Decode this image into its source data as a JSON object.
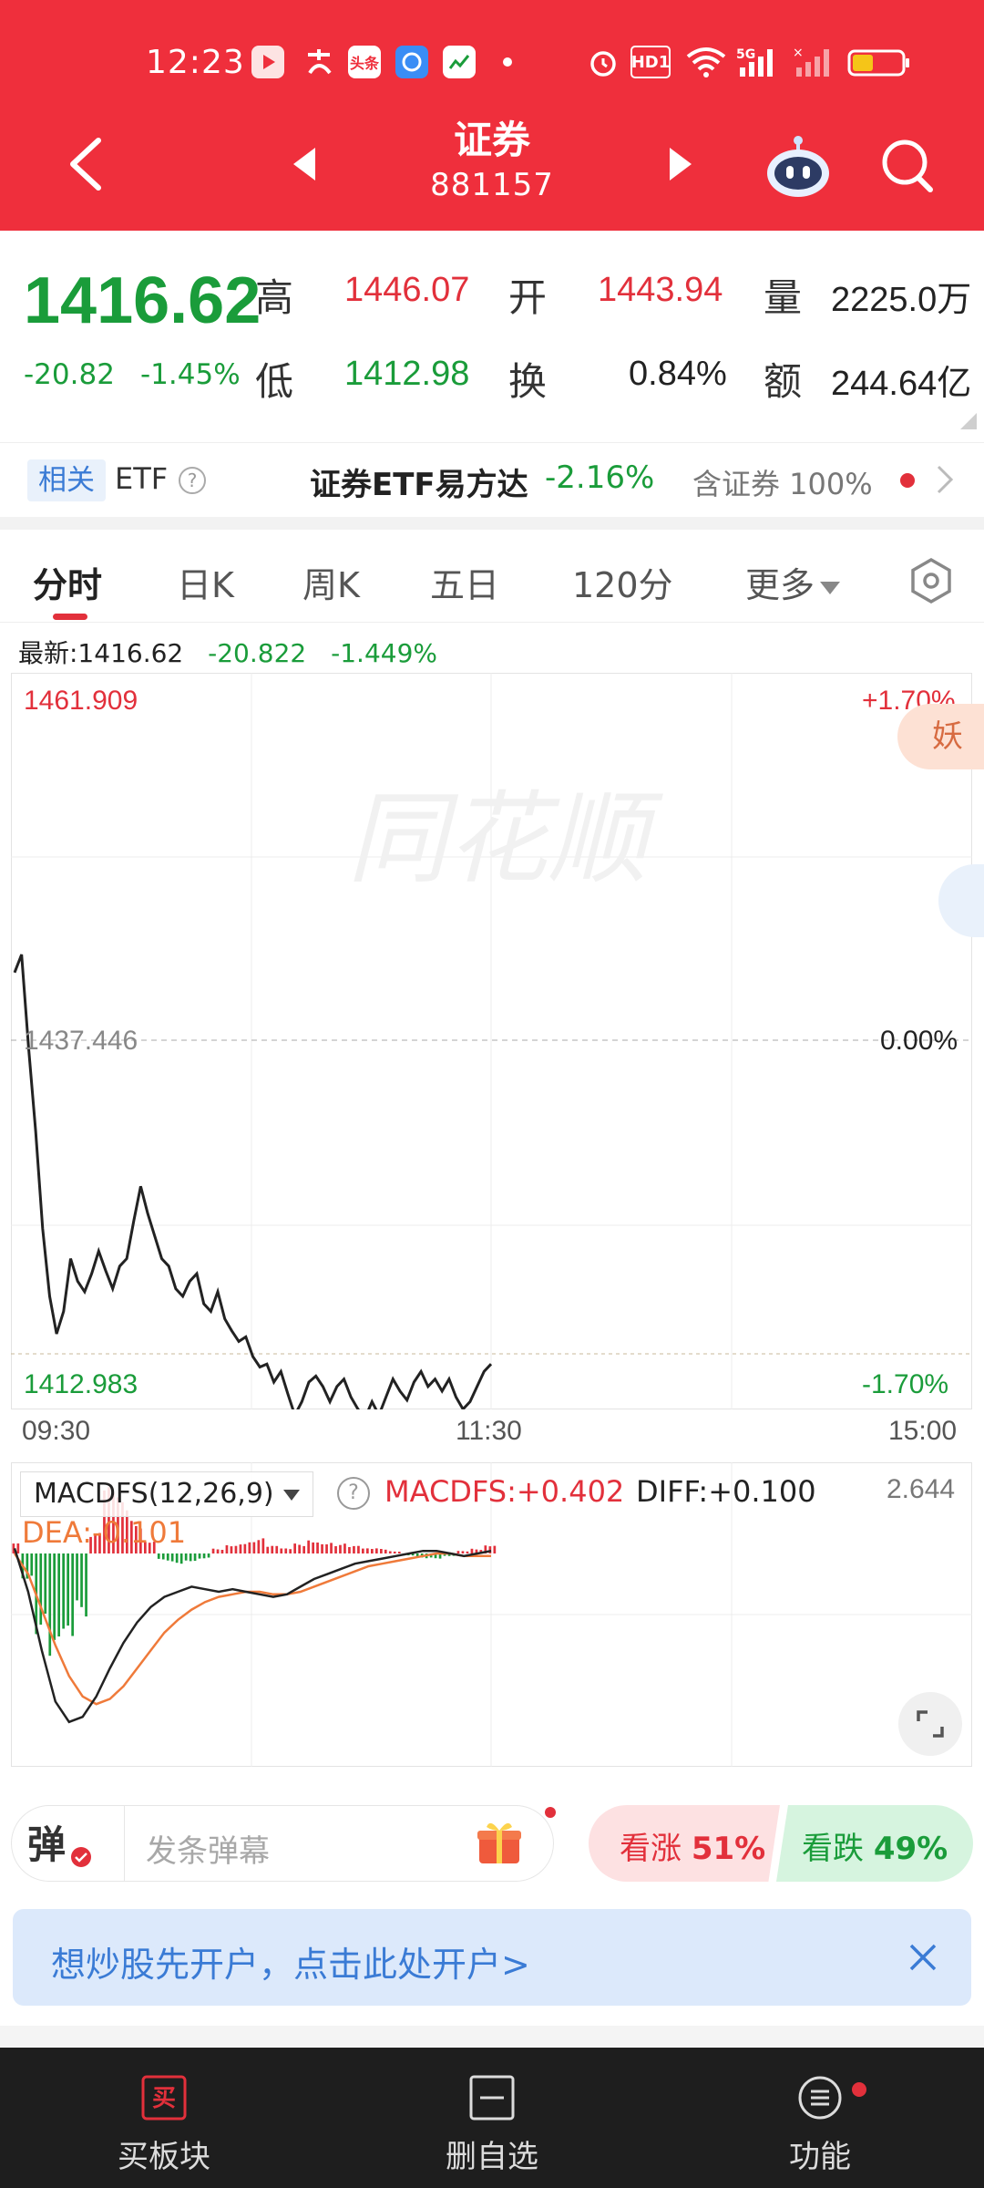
{
  "status_bar": {
    "time": "12:23",
    "icons": [
      "video-app-icon",
      "alipay-icon",
      "toutiao-icon",
      "browser-icon",
      "tonghuashun-icon",
      "more-dot",
      "alarm-icon",
      "hd-icon",
      "wifi-icon",
      "signal-5g-icon",
      "signal-icon",
      "battery-icon"
    ],
    "hd_text": "HD1",
    "net_text": "5G"
  },
  "header": {
    "title": "证券",
    "code": "881157"
  },
  "quote": {
    "price": "1416.62",
    "change": "-20.82",
    "change_pct": "-1.45%",
    "high_label": "高",
    "high": "1446.07",
    "open_label": "开",
    "open": "1443.94",
    "volume_label": "量",
    "volume": "2225.0万",
    "low_label": "低",
    "low": "1412.98",
    "turnover_label": "换",
    "turnover": "0.84%",
    "amount_label": "额",
    "amount": "244.64亿"
  },
  "etf": {
    "tag": "相关",
    "label": "ETF",
    "name": "证券ETF易方达",
    "change": "-2.16%",
    "holding": "含证券 100%"
  },
  "tabs": [
    {
      "label": "分时"
    },
    {
      "label": "日K"
    },
    {
      "label": "周K"
    },
    {
      "label": "五日"
    },
    {
      "label": "120分"
    },
    {
      "label": "更多"
    }
  ],
  "chart_info": {
    "latest": "最新:1416.62",
    "change": "-20.822",
    "change_pct": "-1.449%"
  },
  "price_chart": {
    "top_value": "1461.909",
    "top_pct": "+1.70%",
    "mid_value": "1437.446",
    "mid_pct": "0.00%",
    "bottom_value": "1412.983",
    "bottom_pct": "-1.70%",
    "side_tag": "妖股",
    "watermark": "同花顺",
    "times": [
      "09:30",
      "11:30",
      "15:00"
    ]
  },
  "macd": {
    "selector": "MACDFS(12,26,9)",
    "macdfs": "MACDFS:+0.402",
    "diff": "DIFF:+0.100",
    "dea": "DEA:-0.101",
    "max": "2.644"
  },
  "bullet": {
    "toggle": "弹",
    "placeholder": "发条弹幕"
  },
  "vote": {
    "up_label": "看涨",
    "up_pct": "51%",
    "down_label": "看跌",
    "down_pct": "49%"
  },
  "promo": {
    "text": "想炒股先开户，点击此处开户>"
  },
  "bottom_nav": {
    "buy_icon_text": "买",
    "buy": "买板块",
    "remove": "删自选",
    "functions": "功能"
  },
  "chart_data": {
    "type": "line",
    "x_axis": [
      "09:30",
      "11:30",
      "15:00"
    ],
    "y_range": [
      1412.983,
      1461.909
    ],
    "baseline": 1437.446,
    "grid": true,
    "series": [
      {
        "values": [
          1442.0,
          1443.2,
          1437.0,
          1431.5,
          1425.0,
          1420.5,
          1418.0,
          1419.5,
          1423.0,
          1421.5,
          1420.8,
          1422.0,
          1423.5,
          1422.2,
          1421.0,
          1422.5,
          1423.0,
          1425.5,
          1427.8,
          1426.0,
          1424.5,
          1423.0,
          1422.5,
          1421.0,
          1420.5,
          1421.5,
          1422.0,
          1420.0,
          1419.5,
          1420.8,
          1419.0,
          1418.2,
          1417.5,
          1417.8,
          1416.5,
          1415.8,
          1416.0,
          1414.8,
          1415.5,
          1414.0,
          1412.6,
          1413.5,
          1414.8,
          1415.2,
          1414.5,
          1413.5,
          1414.5,
          1415.0,
          1413.8,
          1413.0,
          1412.4,
          1413.5,
          1412.6,
          1413.8,
          1415.0,
          1414.2,
          1413.6,
          1414.8,
          1415.5,
          1414.5,
          1415.0,
          1414.2,
          1415.0,
          1413.8,
          1413.0,
          1413.5,
          1414.5,
          1415.5,
          1416.0
        ]
      }
    ]
  },
  "macd_data": {
    "type": "bar",
    "diff": [
      0.2,
      -1.5,
      -3.8,
      -5.8,
      -6.6,
      -6.4,
      -5.6,
      -4.5,
      -3.5,
      -2.7,
      -2.1,
      -1.7,
      -1.5,
      -1.3,
      -1.4,
      -1.5,
      -1.4,
      -1.5,
      -1.6,
      -1.7,
      -1.6,
      -1.3,
      -1.0,
      -0.8,
      -0.6,
      -0.4,
      -0.3,
      -0.2,
      -0.1,
      0.0,
      0.1,
      0.1,
      0.0,
      -0.1,
      0.0,
      0.1
    ],
    "dea": [
      0.0,
      -0.8,
      -2.2,
      -3.6,
      -4.8,
      -5.6,
      -5.9,
      -5.7,
      -5.2,
      -4.5,
      -3.8,
      -3.1,
      -2.6,
      -2.2,
      -1.9,
      -1.7,
      -1.6,
      -1.5,
      -1.5,
      -1.6,
      -1.6,
      -1.5,
      -1.3,
      -1.1,
      -0.9,
      -0.7,
      -0.5,
      -0.4,
      -0.3,
      -0.2,
      -0.1,
      0.0,
      0.0,
      -0.1,
      -0.1,
      -0.1
    ],
    "histogram": [
      0.4,
      -1.0,
      -3.2,
      -4.6,
      -4.0,
      -2.6,
      0.8,
      2.6,
      2.2,
      1.4,
      0.6,
      -0.3,
      -0.4,
      -0.3,
      -0.2,
      0.2,
      0.4,
      0.5,
      0.6,
      0.3,
      0.2,
      0.4,
      0.6,
      0.5,
      0.4,
      0.3,
      0.2,
      0.2,
      0.1,
      -0.1,
      -0.2,
      -0.2,
      -0.1,
      0.1,
      0.2,
      0.4
    ]
  }
}
